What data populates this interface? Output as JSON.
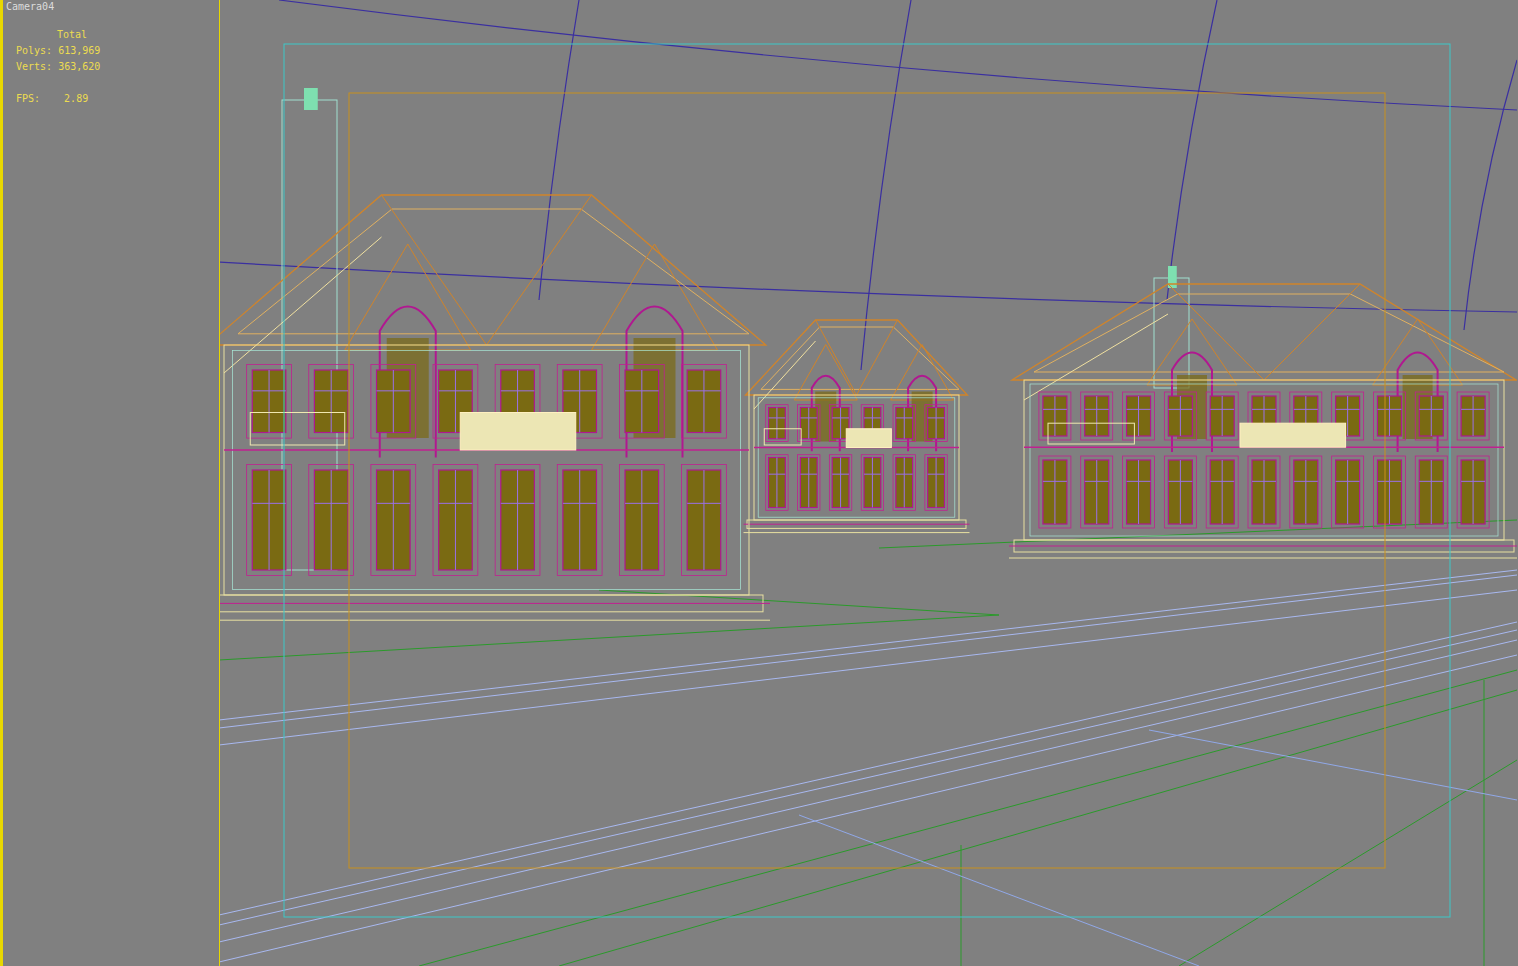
{
  "viewport": {
    "label": "Camera04"
  },
  "stats": {
    "heading": "Total",
    "rows": [
      {
        "label": "Polys:",
        "value": "613,969"
      },
      {
        "label": "Verts:",
        "value": "363,620"
      }
    ],
    "fps": {
      "label": "FPS:",
      "value": "2.89"
    }
  }
}
